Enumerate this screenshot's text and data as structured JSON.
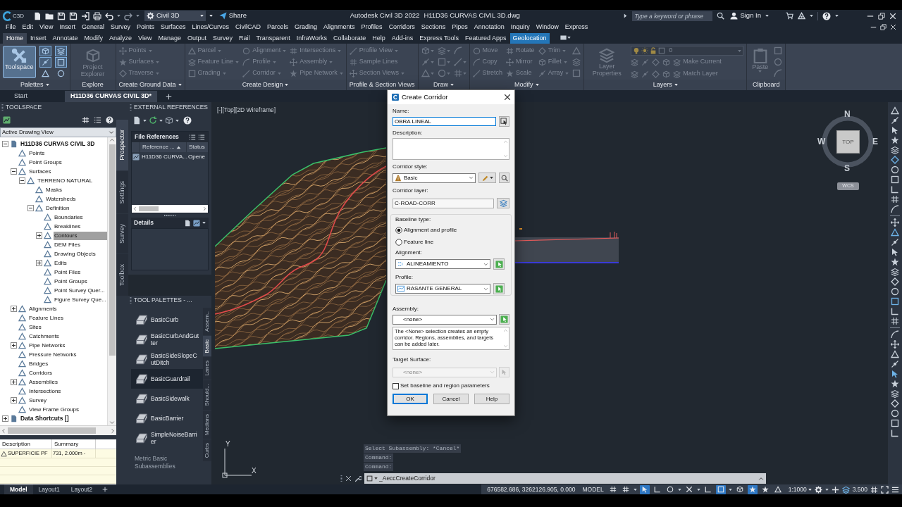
{
  "title_bar": {
    "logo_text": "C3D",
    "workspace": "Civil 3D",
    "share": "Share",
    "app_title": "Autodesk Civil 3D 2022",
    "file_title": "H11D36 CURVAS CIVIL 3D.dwg",
    "search": {
      "placeholder": "Type a keyword or phrase"
    },
    "sign_in": "Sign In"
  },
  "menu_bar": [
    "File",
    "Edit",
    "View",
    "Insert",
    "General",
    "Survey",
    "Points",
    "Surfaces",
    "Lines/Curves",
    "CivilCAD",
    "Parcels",
    "Grading",
    "Alignments",
    "Profiles",
    "Corridors",
    "Sections",
    "Pipes",
    "Annotation",
    "Inquiry",
    "Window",
    "Express"
  ],
  "ribbon_tabs": [
    {
      "label": "Home",
      "selected": true,
      "kind": "standard"
    },
    {
      "label": "Insert",
      "selected": false,
      "kind": "standard"
    },
    {
      "label": "Annotate",
      "selected": false,
      "kind": "standard"
    },
    {
      "label": "Modify",
      "selected": false,
      "kind": "standard"
    },
    {
      "label": "Analyze",
      "selected": false,
      "kind": "standard"
    },
    {
      "label": "View",
      "selected": false,
      "kind": "standard"
    },
    {
      "label": "Manage",
      "selected": false,
      "kind": "standard"
    },
    {
      "label": "Output",
      "selected": false,
      "kind": "standard"
    },
    {
      "label": "Survey",
      "selected": false,
      "kind": "standard"
    },
    {
      "label": "Rail",
      "selected": false,
      "kind": "standard"
    },
    {
      "label": "Transparent",
      "selected": false,
      "kind": "standard"
    },
    {
      "label": "InfraWorks",
      "selected": false,
      "kind": "standard"
    },
    {
      "label": "Collaborate",
      "selected": false,
      "kind": "standard"
    },
    {
      "label": "Help",
      "selected": false,
      "kind": "standard"
    },
    {
      "label": "Add-ins",
      "selected": false,
      "kind": "standard"
    },
    {
      "label": "Express Tools",
      "selected": false,
      "kind": "standard"
    },
    {
      "label": "Featured Apps",
      "selected": false,
      "kind": "standard"
    },
    {
      "label": "Geolocation",
      "selected": false,
      "kind": "contextual"
    }
  ],
  "ribbon_panels": [
    {
      "title": "Palettes",
      "menu": true,
      "disabled": false,
      "kind": "grid",
      "items": [
        {
          "kind": "large",
          "label": "Toolspace",
          "menu": false,
          "selected": true
        },
        {
          "kind": "icon",
          "menu": false,
          "selected": true
        },
        {
          "kind": "icon",
          "menu": false,
          "selected": true
        },
        {
          "kind": "icon",
          "menu": false,
          "selected": false
        },
        {
          "kind": "icon",
          "menu": false,
          "selected": true
        },
        {
          "kind": "icon",
          "menu": false,
          "selected": true
        },
        {
          "kind": "icon",
          "menu": false,
          "selected": false
        }
      ]
    },
    {
      "title": "Explore",
      "menu": false,
      "disabled": true,
      "kind": "grid",
      "items": [
        {
          "kind": "large",
          "label": "Project Explorer",
          "menu": false
        }
      ]
    },
    {
      "title": "Create Ground Data",
      "menu": true,
      "disabled": true,
      "kind": "grid",
      "items": [
        {
          "kind": "small",
          "label": "Points",
          "menu": true
        },
        {
          "kind": "small",
          "label": "Surfaces",
          "menu": true
        },
        {
          "kind": "small",
          "label": "Traverse",
          "menu": true
        }
      ]
    },
    {
      "title": "Create Design",
      "menu": true,
      "disabled": true,
      "kind": "grid",
      "items": [
        {
          "kind": "small",
          "label": "Parcel",
          "menu": true
        },
        {
          "kind": "small",
          "label": "Feature Line",
          "menu": true
        },
        {
          "kind": "small",
          "label": "Grading",
          "menu": true
        },
        {
          "kind": "small",
          "label": "Alignment",
          "menu": true
        },
        {
          "kind": "small",
          "label": "Profile",
          "menu": true
        },
        {
          "kind": "small",
          "label": "Corridor",
          "menu": true
        },
        {
          "kind": "small",
          "label": "Intersections",
          "menu": true
        },
        {
          "kind": "small",
          "label": "Assembly",
          "menu": true
        },
        {
          "kind": "small",
          "label": "Pipe Network",
          "menu": true
        }
      ]
    },
    {
      "title": "Profile & Section Views",
      "menu": false,
      "disabled": true,
      "kind": "grid",
      "items": [
        {
          "kind": "small",
          "label": "Profile View",
          "menu": true
        },
        {
          "kind": "small",
          "label": "Sample Lines",
          "menu": false
        },
        {
          "kind": "small",
          "label": "Section Views",
          "menu": true
        }
      ]
    },
    {
      "title": "Draw",
      "menu": true,
      "disabled": true,
      "kind": "grid",
      "items": [
        {
          "kind": "icon",
          "menu": true
        },
        {
          "kind": "icon",
          "menu": true
        },
        {
          "kind": "icon",
          "menu": true
        },
        {
          "kind": "icon",
          "menu": true
        },
        {
          "kind": "icon",
          "menu": true
        },
        {
          "kind": "icon",
          "menu": true
        },
        {
          "kind": "icon",
          "menu": false
        },
        {
          "kind": "icon",
          "menu": true
        },
        {
          "kind": "icon",
          "menu": true
        }
      ]
    },
    {
      "title": "Modify",
      "menu": true,
      "disabled": true,
      "kind": "grid",
      "items": [
        {
          "kind": "small",
          "label": "Move",
          "menu": false
        },
        {
          "kind": "small",
          "label": "Copy",
          "menu": false
        },
        {
          "kind": "small",
          "label": "Stretch",
          "menu": false
        },
        {
          "kind": "small",
          "label": "Rotate",
          "menu": false
        },
        {
          "kind": "small",
          "label": "Mirror",
          "menu": false
        },
        {
          "kind": "small",
          "label": "Scale",
          "menu": false
        },
        {
          "kind": "small",
          "label": "Trim",
          "menu": true
        },
        {
          "kind": "small",
          "label": "Fillet",
          "menu": true
        },
        {
          "kind": "small",
          "label": "Array",
          "menu": true
        },
        {
          "kind": "icon",
          "menu": false
        },
        {
          "kind": "icon",
          "menu": false
        },
        {
          "kind": "icon",
          "menu": false
        }
      ]
    },
    {
      "title": "Layers",
      "menu": true,
      "disabled": true,
      "kind": "layers",
      "items": [
        {
          "kind": "large",
          "label": "Layer Properties",
          "menu": false
        },
        {
          "kind": "layer_select",
          "value": "0"
        },
        {
          "kind": "small",
          "label": "Make Current",
          "menu": false
        },
        {
          "kind": "small",
          "label": "Match Layer",
          "menu": false
        }
      ]
    },
    {
      "title": "Clipboard",
      "menu": false,
      "disabled": true,
      "kind": "grid",
      "items": [
        {
          "kind": "large",
          "label": "Paste",
          "menu": true
        },
        {
          "kind": "icon",
          "menu": false
        },
        {
          "kind": "icon",
          "menu": false
        },
        {
          "kind": "icon",
          "menu": false
        }
      ]
    }
  ],
  "file_tabs": [
    {
      "label": "Start",
      "selected": false
    },
    {
      "label": "H11D36 CURVAS CIVIL 3D*",
      "selected": true
    }
  ],
  "toolspace": {
    "title": "TOOLSPACE",
    "view": "Active Drawing View",
    "tree": [
      {
        "label": "H11D36 CURVAS CIVIL 3D",
        "kind": "branch",
        "expanded": true,
        "selected": false,
        "children": [
          {
            "label": "Points",
            "kind": "leaf",
            "selected": false
          },
          {
            "label": "Point Groups",
            "kind": "leaf",
            "selected": false
          },
          {
            "label": "Surfaces",
            "kind": "branch",
            "expanded": true,
            "selected": false,
            "children": [
              {
                "label": "TERRENO NATURAL",
                "kind": "branch",
                "expanded": true,
                "selected": false,
                "children": [
                  {
                    "label": "Masks",
                    "kind": "leaf",
                    "selected": false
                  },
                  {
                    "label": "Watersheds",
                    "kind": "leaf",
                    "selected": false
                  },
                  {
                    "label": "Definition",
                    "kind": "branch",
                    "expanded": true,
                    "selected": false,
                    "children": [
                      {
                        "label": "Boundaries",
                        "kind": "leaf",
                        "selected": false
                      },
                      {
                        "label": "Breaklines",
                        "kind": "leaf",
                        "selected": false
                      },
                      {
                        "label": "Contours",
                        "kind": "branch",
                        "expanded": false,
                        "selected": true
                      },
                      {
                        "label": "DEM Files",
                        "kind": "leaf",
                        "selected": false
                      },
                      {
                        "label": "Drawing Objects",
                        "kind": "leaf",
                        "selected": false
                      },
                      {
                        "label": "Edits",
                        "kind": "branch",
                        "expanded": false,
                        "selected": false
                      },
                      {
                        "label": "Point Files",
                        "kind": "leaf",
                        "selected": false
                      },
                      {
                        "label": "Point Groups",
                        "kind": "leaf",
                        "selected": false
                      },
                      {
                        "label": "Point Survey Quer...",
                        "kind": "leaf",
                        "selected": false
                      },
                      {
                        "label": "Figure Survey Que...",
                        "kind": "leaf",
                        "selected": false
                      }
                    ]
                  }
                ]
              }
            ]
          },
          {
            "label": "Alignments",
            "kind": "branch",
            "expanded": false,
            "selected": false
          },
          {
            "label": "Feature Lines",
            "kind": "leaf",
            "selected": false
          },
          {
            "label": "Sites",
            "kind": "leaf",
            "selected": false
          },
          {
            "label": "Catchments",
            "kind": "leaf",
            "selected": false
          },
          {
            "label": "Pipe Networks",
            "kind": "branch",
            "expanded": false,
            "selected": false
          },
          {
            "label": "Pressure Networks",
            "kind": "leaf",
            "selected": false
          },
          {
            "label": "Bridges",
            "kind": "leaf",
            "selected": false
          },
          {
            "label": "Corridors",
            "kind": "leaf",
            "selected": false
          },
          {
            "label": "Assemblies",
            "kind": "branch",
            "expanded": false,
            "selected": false
          },
          {
            "label": "Intersections",
            "kind": "leaf",
            "selected": false
          },
          {
            "label": "Survey",
            "kind": "branch",
            "expanded": false,
            "selected": false
          },
          {
            "label": "View Frame Groups",
            "kind": "leaf",
            "selected": false
          }
        ]
      },
      {
        "label": "Data Shortcuts []",
        "kind": "branch",
        "expanded": false,
        "selected": false
      }
    ],
    "side_tabs": [
      {
        "label": "Prospector",
        "selected": true
      },
      {
        "label": "Settings",
        "selected": false
      },
      {
        "label": "Survey",
        "selected": false
      },
      {
        "label": "Toolbox",
        "selected": false
      }
    ],
    "details": {
      "columns": [
        "Description",
        "Summary"
      ],
      "rows": [
        [
          "SUPERFICIE PF",
          "731, 2.000m -"
        ]
      ]
    }
  },
  "external_references": {
    "title": "EXTERNAL REFERENCES",
    "file_references": {
      "title": "File References",
      "columns": [
        "Reference ...",
        "Status"
      ],
      "rows": [
        [
          "H11D36 CURVA...",
          "Opene"
        ]
      ]
    },
    "details_title": "Details"
  },
  "tool_palettes": {
    "title": "TOOL PALETTES - ...",
    "items": [
      {
        "label": "BasicCurb",
        "selected": false
      },
      {
        "label": "BasicCurbAndGutter",
        "selected": false
      },
      {
        "label": "BasicSideSlopeCutDitch",
        "selected": false
      },
      {
        "label": "BasicGuardrail",
        "selected": true
      },
      {
        "label": "BasicSidewalk",
        "selected": false
      },
      {
        "label": "BasicBarrier",
        "selected": false
      },
      {
        "label": "SimpleNoiseBarrier",
        "selected": false
      }
    ],
    "footer": "Metric Basic Subassemblies",
    "tabs": [
      {
        "label": "Assem..",
        "selected": false
      },
      {
        "label": "Basic",
        "selected": true
      },
      {
        "label": "Lanes",
        "selected": false
      },
      {
        "label": "Should...",
        "selected": false
      },
      {
        "label": "Medians",
        "selected": false
      },
      {
        "label": "Curbs",
        "selected": false
      }
    ]
  },
  "drawing": {
    "viewport_label": "[-][Top][2D Wireframe]",
    "viewcube": {
      "north": "N",
      "south": "S",
      "east": "E",
      "west": "W",
      "face": "TOP",
      "coordinate_system": "WCS"
    },
    "ucs": {
      "y_axis": "Y",
      "x_axis": "X"
    },
    "command_history": [
      "Select Subassembly: *Cancel*",
      "Command:",
      "Command:"
    ],
    "command_input": "_AeccCreateCorridor"
  },
  "dialog": {
    "title": "Create Corridor",
    "name": {
      "label": "Name:",
      "value": "OBRA LINEAL"
    },
    "description": {
      "label": "Description:"
    },
    "corridor_style": {
      "label": "Corridor style:",
      "value": "Basic"
    },
    "corridor_layer": {
      "label": "Corridor layer:",
      "value": "C-ROAD-CORR"
    },
    "baseline": {
      "label": "Baseline type:",
      "options": [
        {
          "label": "Alignment and profile",
          "selected": true
        },
        {
          "label": "Feature line",
          "selected": false
        }
      ],
      "alignment": {
        "label": "Alignment:",
        "value": "ALINEAMIENTO"
      },
      "profile": {
        "label": "Profile:",
        "value": "RASANTE GENERAL"
      }
    },
    "assembly": {
      "label": "Assembly:",
      "value": "<none>",
      "info": "The <None> selection creates an empty corridor. Regions, assemblies, and targets can be added later."
    },
    "target_surface": {
      "label": "Target Surface:",
      "value": "<none>",
      "disabled": true
    },
    "set_parameters": {
      "label": "Set baseline and region parameters",
      "checked": false
    },
    "buttons": [
      {
        "label": "OK",
        "kind": "default"
      },
      {
        "label": "Cancel",
        "kind": "normal"
      },
      {
        "label": "Help",
        "kind": "normal"
      }
    ]
  },
  "status_bar": {
    "layout_tabs": [
      {
        "label": "Model",
        "selected": true
      },
      {
        "label": "Layout1",
        "selected": false
      },
      {
        "label": "Layout2",
        "selected": false
      }
    ],
    "coordinates": "676582.686, 3262126.905, 0.000",
    "space": "MODEL",
    "toggles": [
      {
        "on": false
      },
      {
        "on": false
      },
      {
        "on": true
      },
      {
        "on": false
      },
      {
        "on": false
      },
      {
        "on": false
      },
      {
        "on": false
      },
      {
        "on": true
      },
      {
        "on": false
      },
      {
        "on": true
      },
      {
        "on": false
      },
      {
        "on": false
      }
    ],
    "scale": "1:1000",
    "annotation_value": "3.500"
  }
}
